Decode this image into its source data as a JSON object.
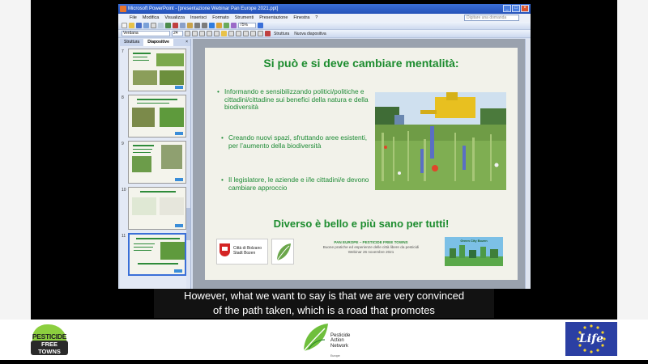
{
  "window": {
    "title": "Microsoft PowerPoint - [presentazione Webinar Pan Europe 2021.ppt]",
    "menu": [
      "File",
      "Modifica",
      "Visualizza",
      "Inserisci",
      "Formato",
      "Strumenti",
      "Presentazione",
      "Finestra",
      "?"
    ],
    "ask_placeholder": "Digitare una domanda",
    "font_name": "Verdana",
    "font_size": "24",
    "zoom": "75%",
    "layout_label": "Struttura",
    "new_slide_label": "Nuova diapositiva"
  },
  "panel": {
    "tabs": [
      "Struttura",
      "Diapositive"
    ],
    "close": "×",
    "slide_numbers": [
      "7",
      "8",
      "9",
      "10",
      "11"
    ]
  },
  "slide": {
    "title": "Si può e si deve cambiare mentalità:",
    "bullets": [
      "Informando e sensibilizzando politici/politiche e cittadini/cittadine sui benefici della natura e della biodiversità",
      "Creando nuovi spazi, sfruttando aree esistenti, per l’aumento della biodiversità",
      "Il legislatore, le aziende e i/le cittadini/e devono cambiare approccio"
    ],
    "slogan": "Diverso è bello e più sano per tutti!",
    "city_logo": [
      "Città di Bolzano",
      "Stadt Bozen"
    ],
    "footer": [
      "PAN EUROPE – PESTICIDE FREE TOWNS",
      "Buone pratiche ed esperienze delle città libere da pesticidi",
      "Webinar 26 novembre 2021"
    ],
    "green_logo": "Green City Bozen"
  },
  "subtitles": [
    "However, what we want to say is that we are very convinced",
    "of the path taken, which is a road that promotes"
  ],
  "logos": {
    "pft_line1": "PESTICIDE",
    "pft_line2": "FREE TOWNS",
    "pan_lines": [
      "Pesticide",
      "Action",
      "Network"
    ],
    "pan_region": "Europe",
    "life": "Life"
  },
  "colors": {
    "slide_green": "#1c8c2e",
    "titlebar_blue": "#2451b8",
    "life_blue": "#2b3fa3"
  }
}
